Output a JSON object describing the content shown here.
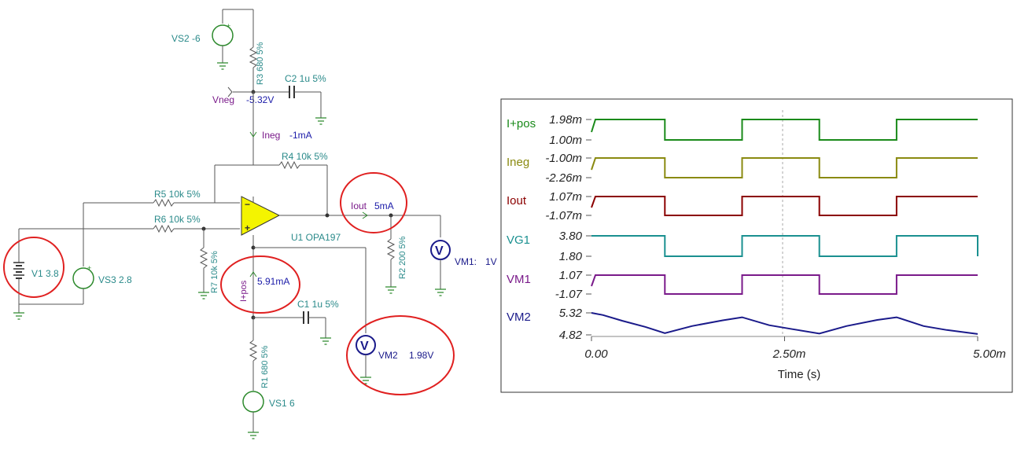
{
  "schematic": {
    "components": {
      "vs2": "VS2 -6",
      "r3": "R3 680 5%",
      "c2": "C2 1u 5%",
      "vneg_name": "Vneg",
      "vneg_value": "-5.32V",
      "ineg_name": "Ineg",
      "ineg_value": "-1mA",
      "r4": "R4 10k 5%",
      "r5": "R5 10k 5%",
      "r6": "R6 10k 5%",
      "iout_name": "Iout",
      "iout_value": "5mA",
      "u1": "U1 OPA197",
      "r2": "R2 200 5%",
      "vm1_name": "VM1:",
      "vm1_value": "1V",
      "v1": "V1 3.8",
      "vs3": "VS3 2.8",
      "r7": "R7 10k 5%",
      "ipos_name": "I+pos",
      "ipos_value": "5.91mA",
      "c1": "C1 1u 5%",
      "vm2_name": "VM2",
      "vm2_value": "1.98V",
      "r1": "R1 680 5%",
      "vs1": "VS1 6",
      "meter_glyph": "V",
      "opamp_minus": "−",
      "opamp_plus": "+"
    },
    "highlight_color": "#e02020"
  },
  "chart_data": {
    "type": "line",
    "xlabel": "Time (s)",
    "x_ticks": [
      "0.00",
      "2.50m",
      "5.00m"
    ],
    "xlim": [
      0,
      5
    ],
    "x_unit": "ms",
    "grid": "dashed vertical at 2.50m",
    "series": [
      {
        "name": "I+pos",
        "color": "#1a8a1a",
        "y_top": "1.98m",
        "y_bottom": "1.00m",
        "kind": "square"
      },
      {
        "name": "Ineg",
        "color": "#8a8a10",
        "y_top": "-1.00m",
        "y_bottom": "-2.26m",
        "kind": "square"
      },
      {
        "name": "Iout",
        "color": "#8b0000",
        "y_top": "1.07m",
        "y_bottom": "-1.07m",
        "kind": "square"
      },
      {
        "name": "VG1",
        "color": "#1a9090",
        "y_top": "3.80",
        "y_bottom": "1.80",
        "kind": "square_no_ramp"
      },
      {
        "name": "VM1",
        "color": "#7a1a8a",
        "y_top": "1.07",
        "y_bottom": "-1.07",
        "kind": "square"
      },
      {
        "name": "VM2",
        "color": "#1a1a8a",
        "y_top": "5.32",
        "y_bottom": "4.82",
        "kind": "ripple"
      }
    ],
    "transitions_ms": [
      0.95,
      1.95,
      2.95,
      3.95
    ],
    "vm2_points": [
      [
        0,
        5.32
      ],
      [
        0.15,
        5.27
      ],
      [
        0.4,
        5.14
      ],
      [
        0.7,
        5.0
      ],
      [
        0.95,
        4.86
      ],
      [
        1.3,
        5.02
      ],
      [
        1.7,
        5.15
      ],
      [
        1.95,
        5.22
      ],
      [
        2.3,
        5.04
      ],
      [
        2.6,
        4.95
      ],
      [
        2.95,
        4.85
      ],
      [
        3.3,
        5.02
      ],
      [
        3.7,
        5.16
      ],
      [
        3.95,
        5.22
      ],
      [
        4.3,
        5.02
      ],
      [
        4.6,
        4.93
      ],
      [
        5.0,
        4.84
      ]
    ]
  }
}
